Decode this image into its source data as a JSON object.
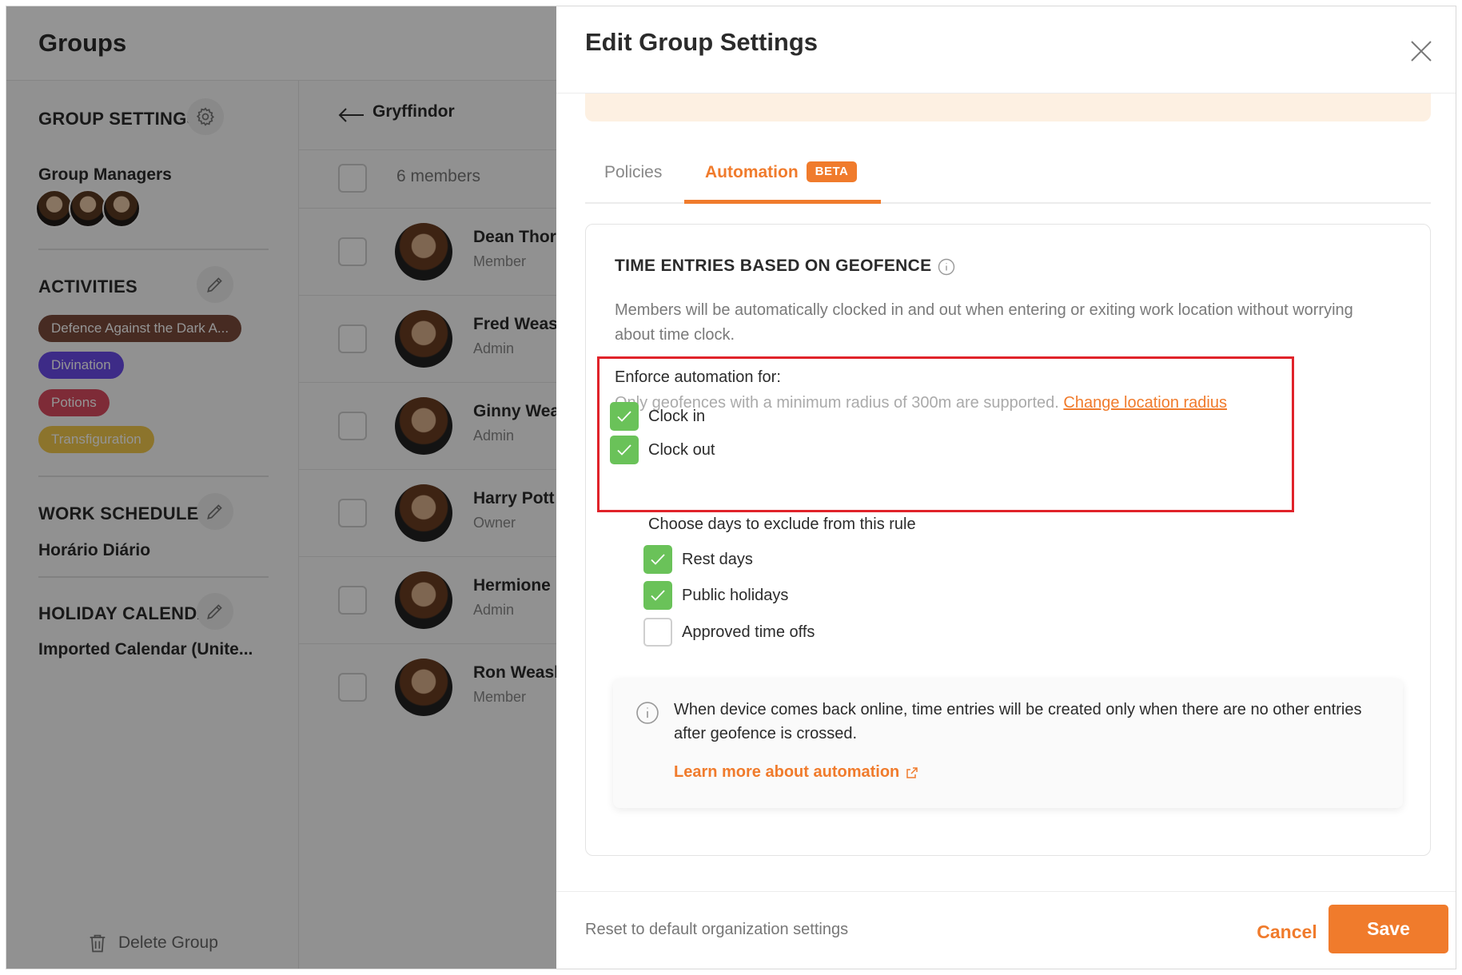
{
  "app": {
    "title": "Groups"
  },
  "sidebar": {
    "group_settings_heading": "GROUP SETTINGS",
    "group_managers_label": "Group Managers",
    "activities_heading": "ACTIVITIES",
    "activities": [
      {
        "label": "Defence Against the Dark A...",
        "color": "#7a4b3c"
      },
      {
        "label": "Divination",
        "color": "#6a4be8"
      },
      {
        "label": "Potions",
        "color": "#d94b5f"
      },
      {
        "label": "Transfiguration",
        "color": "#f2c94c"
      }
    ],
    "work_schedule_heading": "WORK SCHEDULE",
    "work_schedule_value": "Horário Diário",
    "holiday_calendar_heading": "HOLIDAY CALENDAR",
    "holiday_calendar_value": "Imported Calendar (Unite...",
    "delete_label": "Delete Group"
  },
  "members_panel": {
    "group_name": "Gryffindor",
    "members_count": "6 members",
    "members": [
      {
        "name": "Dean Thor",
        "role": "Member"
      },
      {
        "name": "Fred Weas",
        "role": "Admin"
      },
      {
        "name": "Ginny Wea",
        "role": "Admin"
      },
      {
        "name": "Harry Pott",
        "role": "Owner"
      },
      {
        "name": "Hermione",
        "role": "Admin"
      },
      {
        "name": "Ron Weasl",
        "role": "Member"
      }
    ]
  },
  "modal": {
    "title": "Edit Group Settings",
    "tabs": {
      "policies": "Policies",
      "automation": "Automation",
      "beta_badge": "BETA"
    },
    "section_title": "TIME ENTRIES BASED ON GEOFENCE",
    "section_description": "Members will be automatically clocked in and out when entering or exiting work location without worrying about time clock.",
    "enforce_label": "Enforce automation for:",
    "radius_note": "Only geofences with a minimum radius of 300m are supported.",
    "radius_link": "Change location radius",
    "clock_in": {
      "label": "Clock in",
      "checked": true
    },
    "clock_out": {
      "label": "Clock out",
      "checked": true
    },
    "exclude_label": "Choose days to exclude from this rule",
    "rest_days": {
      "label": "Rest days",
      "checked": true
    },
    "public_holidays": {
      "label": "Public holidays",
      "checked": true
    },
    "approved_time_offs": {
      "label": "Approved time offs",
      "checked": false
    },
    "note_text": "When device comes back online, time entries will be created only when there are no other entries after geofence is crossed.",
    "learn_more": "Learn more about automation",
    "footer": {
      "reset_link": "Reset to default organization settings",
      "cancel": "Cancel",
      "save": "Save"
    }
  },
  "colors": {
    "accent": "#f07b2c",
    "check_green": "#6ac259",
    "highlight_red": "#e0232a"
  }
}
